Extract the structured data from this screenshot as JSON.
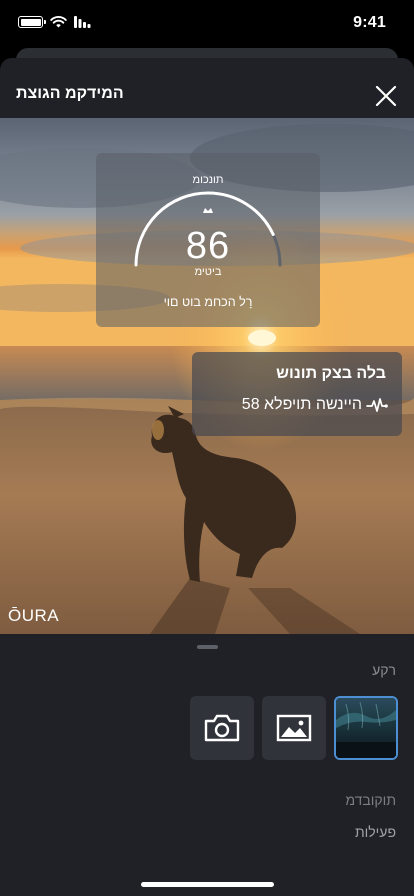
{
  "status_bar": {
    "time": "9:41"
  },
  "sheet": {
    "title": "המידקמ הגוצת",
    "close_icon": "close-icon"
  },
  "preview": {
    "readiness_card": {
      "title": "תונכומ",
      "score": "86",
      "rating": "ביטימ",
      "caption": "רָל הכחמ בוט םוי",
      "ring_fraction": 0.86
    },
    "hr_card": {
      "title": "בלה בצק תונוש",
      "value": "58 היינשה תויפלא",
      "icon": "heart-rate-icon"
    },
    "logo": "ŌURA"
  },
  "panel": {
    "main_section_label": "רקע",
    "options": [
      {
        "name": "camera",
        "icon": "camera-icon"
      },
      {
        "name": "gallery",
        "icon": "image-icon"
      },
      {
        "name": "aurora-background",
        "icon": "aurora-thumbnail",
        "selected": true
      }
    ],
    "secondary_section_label": "תוקובדמ",
    "activity_section_label": "פעילות"
  },
  "colors": {
    "sheet_bg": "#1f2126",
    "option_bg": "#30333a",
    "selected_border": "#4c8fd3",
    "muted_text": "#8a8d93"
  }
}
